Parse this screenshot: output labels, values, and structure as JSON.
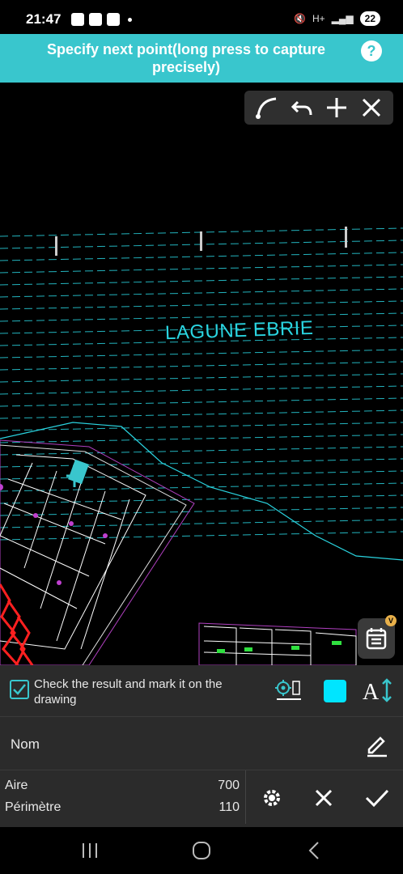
{
  "status_bar": {
    "time": "21:47",
    "battery": "22",
    "network_label": "H+"
  },
  "prompt": {
    "text": "Specify next point(long press to capture precisely)",
    "help_icon": "?"
  },
  "toolbar": {
    "icons": [
      "arc-icon",
      "undo-icon",
      "plus-icon",
      "close-icon"
    ]
  },
  "drawing": {
    "label": "LAGUNE EBRIE"
  },
  "calendar": {
    "badge": "V"
  },
  "options": {
    "check_label": "Check the result and mark it on the drawing",
    "checked": true,
    "swatch_color": "#00e5ff"
  },
  "name_field": {
    "label": "Nom"
  },
  "measurements": {
    "area_label": "Aire",
    "area_value": "700",
    "perimeter_label": "Périmètre",
    "perimeter_value": "110"
  },
  "colors": {
    "accent": "#39c6cd",
    "lagoon_lines": "#2ad4e0",
    "panel": "#2b2b2b"
  }
}
